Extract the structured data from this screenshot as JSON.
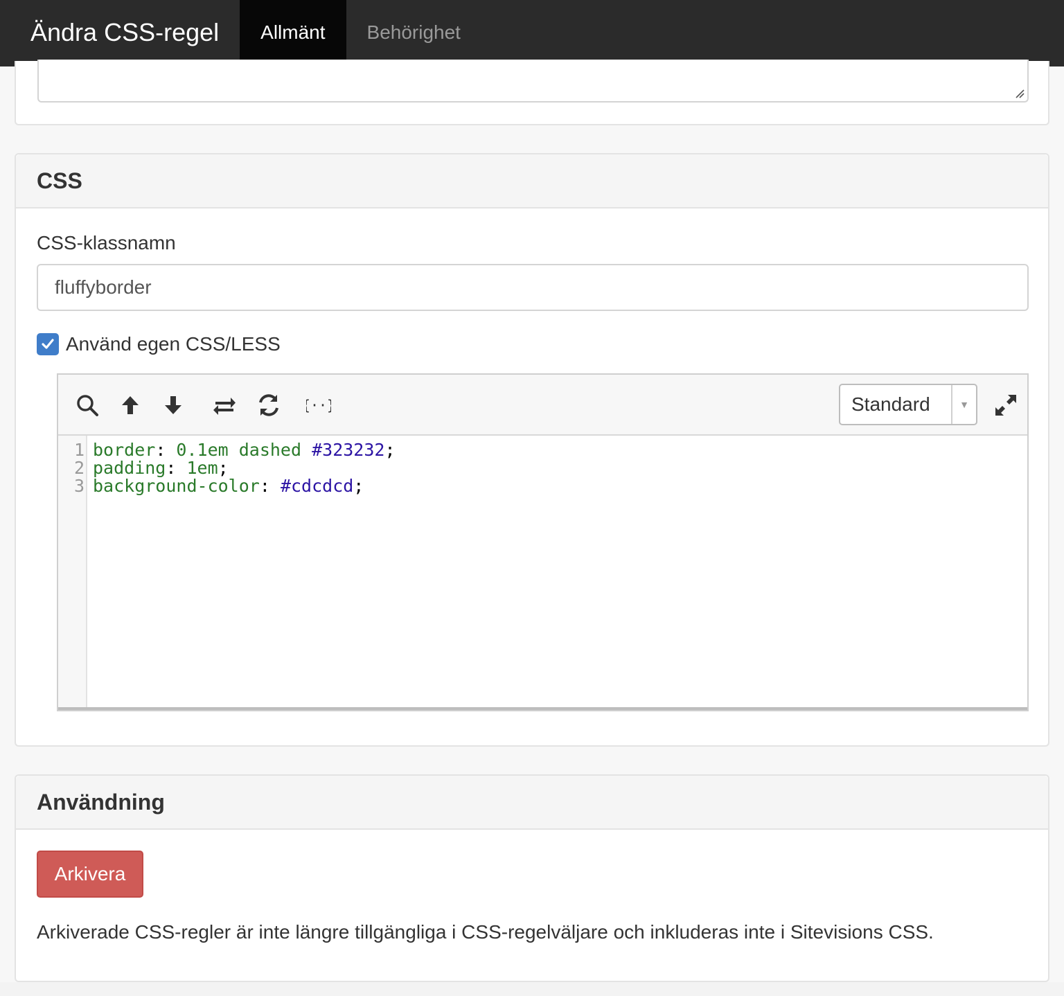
{
  "header": {
    "title": "Ändra CSS-regel",
    "tabs": [
      {
        "label": "Allmänt",
        "active": true
      },
      {
        "label": "Behörighet",
        "active": false
      }
    ]
  },
  "css_panel": {
    "heading": "CSS",
    "class_name_label": "CSS-klassnamn",
    "class_name_value": "fluffyborder",
    "custom_css_label": "Använd egen CSS/LESS",
    "custom_css_checked": true,
    "editor": {
      "toolbar_icons": [
        "search-icon",
        "arrow-up-icon",
        "arrow-down-icon",
        "swap-icon",
        "refresh-icon",
        "format-braces-icon"
      ],
      "mode_value": "Standard",
      "lines": [
        {
          "number": "1",
          "prop": "border",
          "sep": ": ",
          "value_plain": "0.1em dashed ",
          "value_color": "#323232",
          "end": ";"
        },
        {
          "number": "2",
          "prop": "padding",
          "sep": ": ",
          "value_plain": "1em",
          "value_color": "",
          "end": ";"
        },
        {
          "number": "3",
          "prop": "background-color",
          "sep": ": ",
          "value_plain": "",
          "value_color": "#cdcdcd",
          "end": ";"
        }
      ]
    }
  },
  "usage_panel": {
    "heading": "Användning",
    "archive_button": "Arkivera",
    "description": "Arkiverade CSS-regler är inte längre tillgängliga i CSS-regelväljare och inkluderas inte i Sitevisions CSS."
  },
  "colors": {
    "topbar_bg": "#2b2b2b",
    "active_tab_bg": "#070707",
    "checkbox": "#3f7dc9",
    "danger": "#cf5b57",
    "code_keyword": "#2a7a2a",
    "code_color": "#2c14a4"
  }
}
